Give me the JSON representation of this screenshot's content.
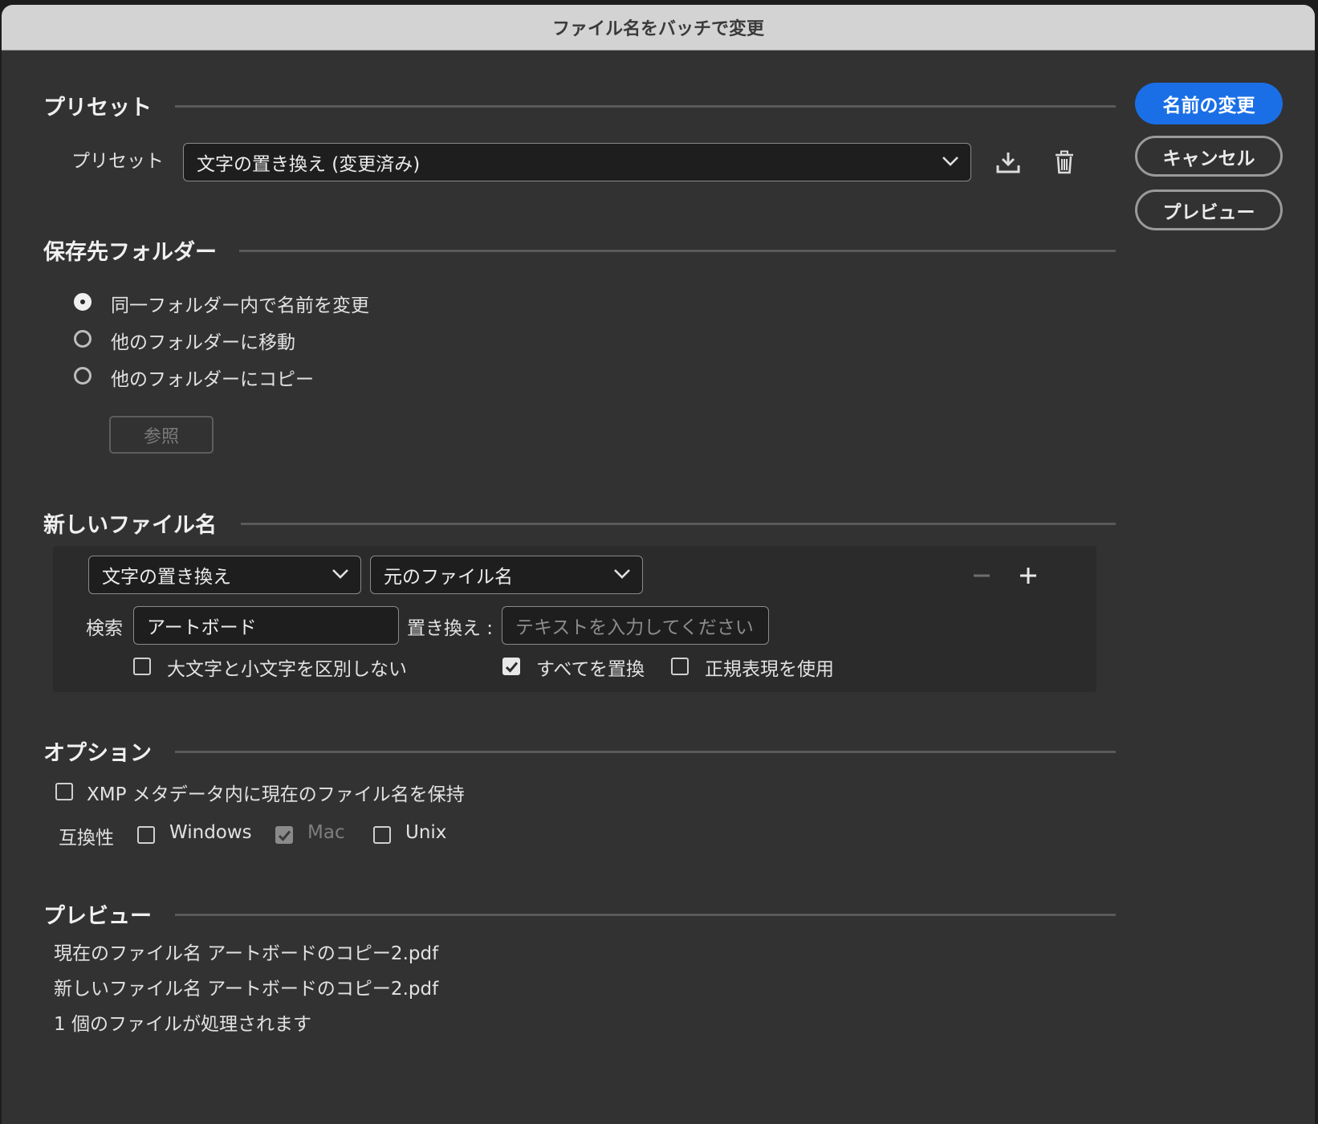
{
  "window": {
    "title": "ファイル名をバッチで変更"
  },
  "buttons": {
    "rename": "名前の変更",
    "cancel": "キャンセル",
    "preview": "プレビュー"
  },
  "preset": {
    "section_title": "プリセット",
    "label": "プリセット",
    "selected": "文字の置き換え (変更済み)",
    "icons": [
      "download-icon",
      "trash-icon"
    ]
  },
  "destination": {
    "section_title": "保存先フォルダー",
    "options": [
      "同一フォルダー内で名前を変更",
      "他のフォルダーに移動",
      "他のフォルダーにコピー"
    ],
    "selected_index": 0,
    "browse_label": "参照"
  },
  "new_name": {
    "section_title": "新しいファイル名",
    "rule_type": "文字の置き換え",
    "rule_source": "元のファイル名",
    "search_label": "検索",
    "search_value": "アートボード",
    "replace_label": "置き換え :",
    "replace_placeholder": "テキストを入力してください",
    "ignore_case_label": "大文字と小文字を区別しない",
    "ignore_case": false,
    "replace_all_label": "すべてを置換",
    "replace_all": true,
    "regex_label": "正規表現を使用",
    "regex": false
  },
  "options": {
    "section_title": "オプション",
    "xmp_label": "XMP メタデータ内に現在のファイル名を保持",
    "xmp": false,
    "compat_label": "互換性",
    "compat": [
      {
        "label": "Windows",
        "checked": false,
        "disabled": false
      },
      {
        "label": "Mac",
        "checked": true,
        "disabled": true
      },
      {
        "label": "Unix",
        "checked": false,
        "disabled": false
      }
    ]
  },
  "preview": {
    "section_title": "プレビュー",
    "current": "現在のファイル名 アートボードのコピー2.pdf",
    "new": "新しいファイル名 アートボードのコピー2.pdf",
    "count": "1 個のファイルが処理されます"
  },
  "colors": {
    "accent": "#1a6fe6",
    "background": "#323232",
    "titlebar": "#d3d3d3"
  }
}
